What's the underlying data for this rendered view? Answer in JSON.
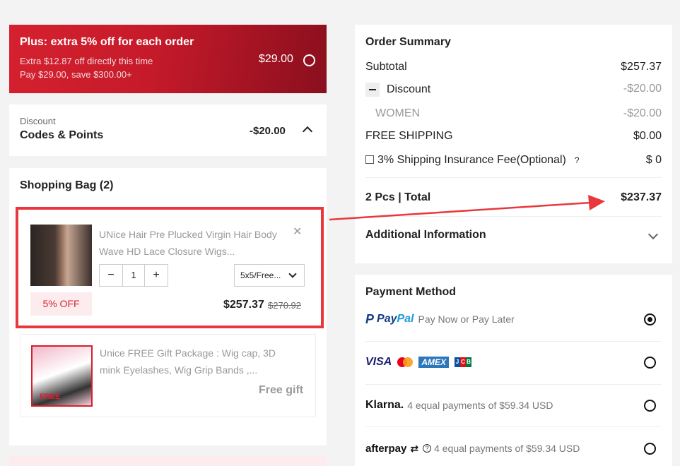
{
  "plus": {
    "title": "Plus: extra 5% off for each order",
    "line1": "Extra $12.87 off directly this time",
    "line2": "Pay $29.00, save $300.00+",
    "price": "$29.00"
  },
  "discount": {
    "label": "Discount",
    "sub": "Codes & Points",
    "amount": "-$20.00"
  },
  "bag": {
    "title": "Shopping Bag (2)",
    "item": {
      "name": "UNice Hair Pre Plucked Virgin Hair Body Wave HD Lace Closure Wigs...",
      "qty": "1",
      "minus": "−",
      "plus": "+",
      "variant": "5x5/Free...",
      "badge": "5% OFF",
      "price": "$257.37",
      "old_price": "$270.92",
      "close": "✕"
    },
    "gift": {
      "name": "Unice FREE Gift Package : Wig cap, 3D mink Eyelashes, Wig Grip Bands ,...",
      "tag": "Free gift",
      "thumb_text": "FREE"
    }
  },
  "summary": {
    "title": "Order Summary",
    "subtotal_label": "Subtotal",
    "subtotal": "$257.37",
    "discount_label": "Discount",
    "discount": "-$20.00",
    "women_label": "WOMEN",
    "women": "-$20.00",
    "shipping_label": "FREE SHIPPING",
    "shipping": "$0.00",
    "insurance_label": "3% Shipping Insurance Fee(Optional)",
    "insurance_q": "?",
    "insurance": "$ 0",
    "total_label": "2 Pcs | Total",
    "total": "$237.37",
    "additional": "Additional Information"
  },
  "payment": {
    "title": "Payment Method",
    "paypal_note": "Pay Now or Pay Later",
    "paypal_name": "Pay",
    "paypal_name2": "Pal",
    "visa": "VISA",
    "amex": "AMEX",
    "klarna": "Klarna.",
    "klarna_note": "4 equal payments of $59.34 USD",
    "afterpay": "afterpay",
    "afterpay_note": "4 equal payments of $59.34 USD",
    "selected": "paypal"
  },
  "colors": {
    "brand_red": "#d5212f",
    "highlight": "#e8383d"
  }
}
